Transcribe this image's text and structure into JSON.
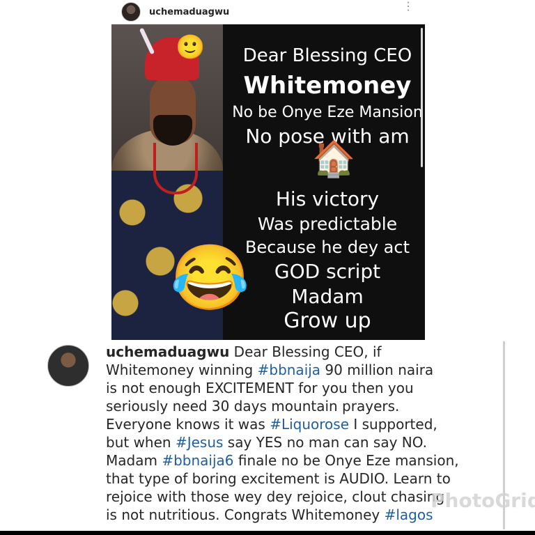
{
  "post": {
    "username": "uchemaduagwu",
    "more_icon": "⋮"
  },
  "meme": {
    "emoji_smile": "🙂",
    "emoji_house": "🏠",
    "emoji_laugh": "😂",
    "lines": [
      "Dear Blessing CEO",
      "Whitemoney",
      "No be Onye Eze Mansion",
      "No pose with am",
      "His victory",
      "Was predictable",
      "Because he dey act",
      "GOD script",
      "Madam",
      "Grow up"
    ]
  },
  "caption": {
    "username": "uchemaduagwu",
    "line1_text": " Dear Blessing CEO, if",
    "line2_a": "Whitemoney winning ",
    "line2_tag": "#bbnaija",
    "line2_b": " 90 million naira",
    "line3": "is not enough EXCITEMENT for you then you",
    "line4": "seriously need 30 days mountain prayers.",
    "line5_a": "Everyone knows it was ",
    "line5_tag": "#Liquorose",
    "line5_b": " I supported,",
    "line6_a": "but when ",
    "line6_tag": "#Jesus",
    "line6_b": " say YES no man can say NO.",
    "line7_a": "Madam ",
    "line7_tag": "#bbnaija6",
    "line7_b": " finale no be Onye Eze mansion,",
    "line8": "that type of boring excitement is AUDIO. Learn to",
    "line9": "rejoice with those wey dey rejoice, clout chasing",
    "line10_a": "is not nutritious. Congrats Whitemoney ",
    "line10_tag": "#lagos"
  },
  "watermark": "PhotoGrid",
  "colors": {
    "hashtag": "#1e5fa3",
    "meme_background": "#0f0f0f",
    "meme_text": "#ffffff"
  }
}
